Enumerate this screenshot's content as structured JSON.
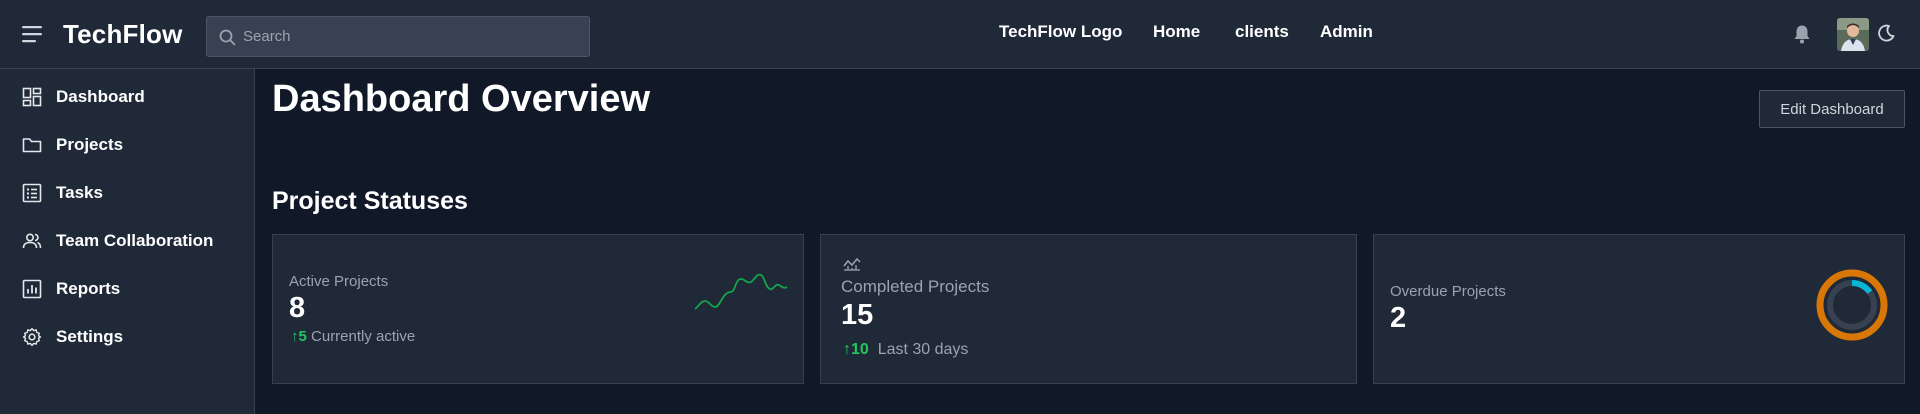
{
  "header": {
    "brand": "TechFlow",
    "search_placeholder": "Search",
    "nav": [
      "TechFlow Logo",
      "Home",
      "clients",
      "Admin"
    ]
  },
  "sidebar": {
    "items": [
      {
        "label": "Dashboard",
        "icon": "dashboard-icon"
      },
      {
        "label": "Projects",
        "icon": "folder-icon"
      },
      {
        "label": "Tasks",
        "icon": "task-list-icon"
      },
      {
        "label": "Team Collaboration",
        "icon": "team-icon"
      },
      {
        "label": "Reports",
        "icon": "bar-chart-icon"
      },
      {
        "label": "Settings",
        "icon": "gear-icon"
      }
    ]
  },
  "main": {
    "title": "Dashboard Overview",
    "edit_button": "Edit Dashboard",
    "section_title": "Project Statuses",
    "cards": [
      {
        "label": "Active Projects",
        "value": "8",
        "delta": "5",
        "delta_text": "Currently active"
      },
      {
        "label": "Completed Projects",
        "value": "15",
        "delta": "10",
        "delta_text": "Last 30 days"
      },
      {
        "label": "Overdue Projects",
        "value": "2",
        "progress_fraction": 0.15
      }
    ]
  },
  "colors": {
    "accent_green": "#22c55e",
    "ring_orange": "#d97706",
    "ring_cyan": "#06b6d4"
  }
}
